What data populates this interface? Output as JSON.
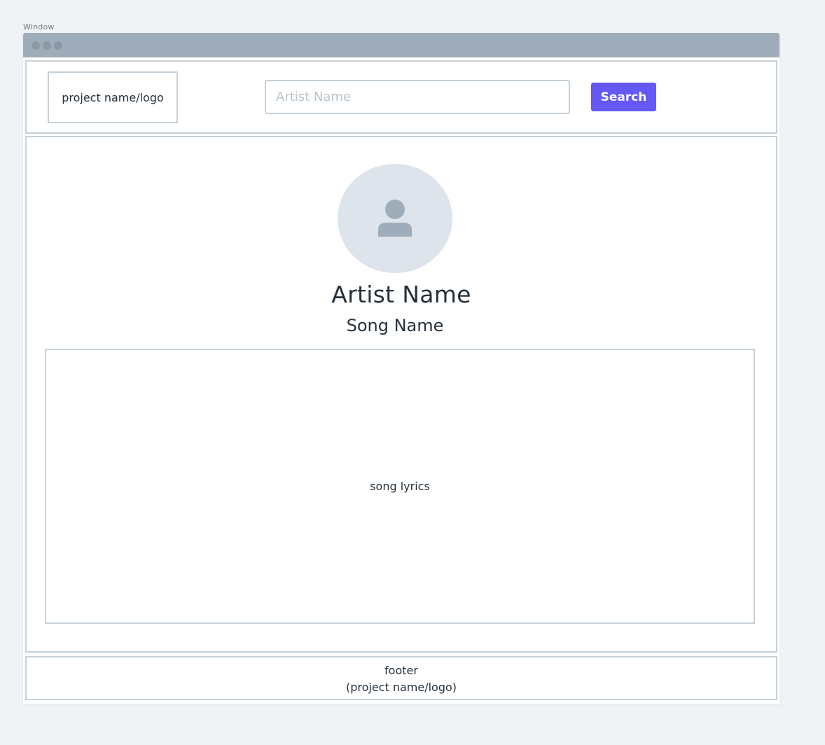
{
  "window": {
    "label": "Window"
  },
  "header": {
    "logo_text": "project name/logo",
    "search": {
      "placeholder": "Artist Name",
      "value": ""
    },
    "search_button_label": "Search"
  },
  "main": {
    "avatar_icon": "user-icon",
    "artist_name": "Artist Name",
    "song_name": "Song Name",
    "lyrics_text": "song lyrics"
  },
  "footer": {
    "line1": "footer",
    "line2": "(project name/logo)"
  },
  "colors": {
    "accent": "#6558f5",
    "border": "#c5d1da",
    "titlebar": "#9eadb9",
    "avatar_bg": "#dee4ec",
    "text": "#24313d",
    "background": "#f0f3f5"
  }
}
